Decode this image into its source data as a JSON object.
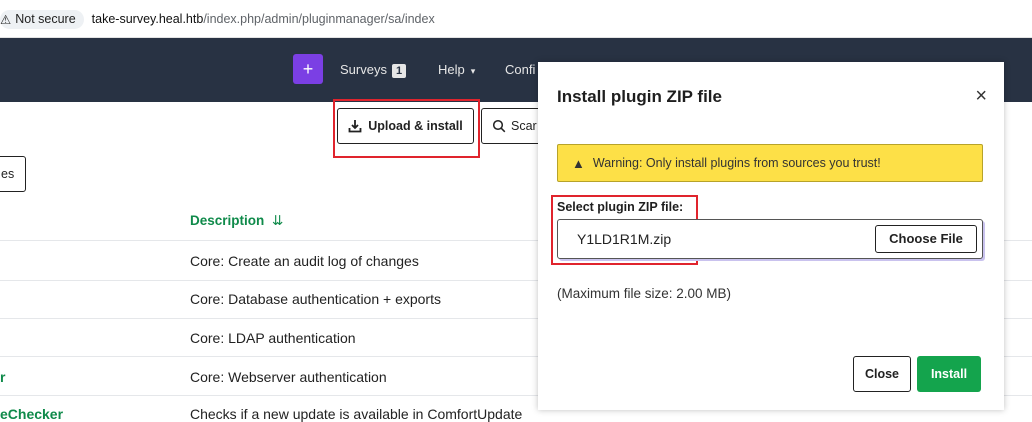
{
  "browser": {
    "security_label": "Not secure",
    "url_host": "take-survey.heal.htb",
    "url_path": "/index.php/admin/pluginmanager/sa/index"
  },
  "navbar": {
    "plus_label": "+",
    "surveys_label": "Surveys",
    "surveys_count": "1",
    "help_label": "Help",
    "config_label": "Confi"
  },
  "toolbar": {
    "upload_label": "Upload & install",
    "scan_label": "Scar",
    "left_button_label": "es"
  },
  "table": {
    "description_header": "Description",
    "rows": [
      {
        "name": "",
        "description": "Core: Create an audit log of changes"
      },
      {
        "name": "",
        "description": "Core: Database authentication + exports"
      },
      {
        "name": "",
        "description": "Core: LDAP authentication"
      },
      {
        "name": "r",
        "description": "Core: Webserver authentication"
      },
      {
        "name": "eChecker",
        "description": "Checks if a new update is available in ComfortUpdate"
      }
    ]
  },
  "modal": {
    "title": "Install plugin ZIP file",
    "close_symbol": "×",
    "warning_text": "Warning: Only install plugins from sources you trust!",
    "field_label": "Select plugin ZIP file:",
    "file_name": "Y1LD1R1M.zip",
    "choose_file_label": "Choose File",
    "max_size_text": "(Maximum file size: 2.00 MB)",
    "close_button": "Close",
    "install_button": "Install"
  },
  "colors": {
    "navbar": "#283243",
    "accent_purple": "#7b3fe4",
    "link_green": "#0f8a4a",
    "warning_yellow": "#fde047",
    "install_green": "#14a44d",
    "highlight_red": "#e0242d"
  }
}
